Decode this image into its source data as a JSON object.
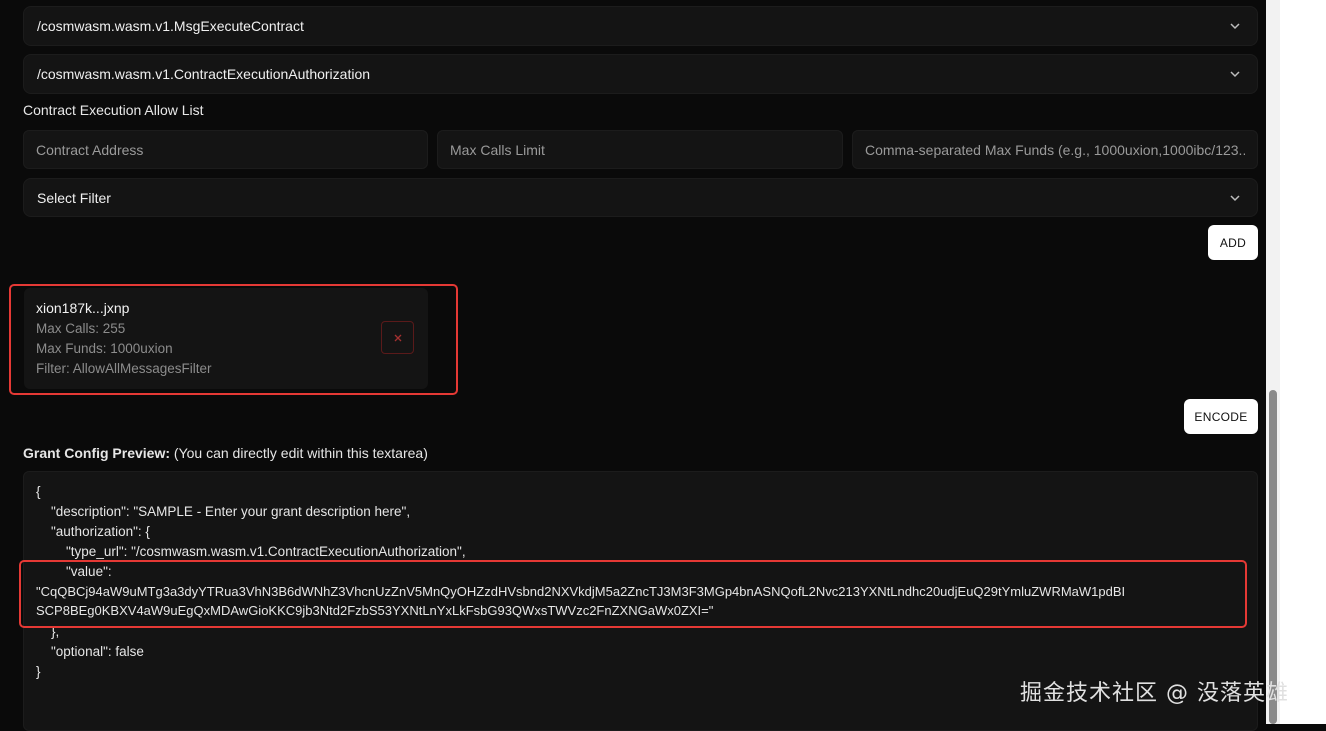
{
  "message_type_select": {
    "value": "/cosmwasm.wasm.v1.MsgExecuteContract"
  },
  "authorization_type_select": {
    "value": "/cosmwasm.wasm.v1.ContractExecutionAuthorization"
  },
  "allow_list": {
    "label": "Contract Execution Allow List",
    "contract_address_placeholder": "Contract Address",
    "max_calls_placeholder": "Max Calls Limit",
    "max_funds_placeholder": "Comma-separated Max Funds (e.g., 1000uxion,1000ibc/123...)",
    "filter_select": "Select Filter",
    "add_label": "ADD"
  },
  "entry": {
    "address": "xion187k...jxnp",
    "max_calls": "Max Calls: 255",
    "max_funds": "Max Funds: 1000uxion",
    "filter": "Filter: AllowAllMessagesFilter"
  },
  "encode_label": "ENCODE",
  "preview": {
    "label_bold": "Grant Config Preview:",
    "label_rest": " (You can directly edit within this textarea)",
    "lines": [
      "{",
      "    \"description\": \"SAMPLE - Enter your grant description here\",",
      "    \"authorization\": {",
      "        \"type_url\": \"/cosmwasm.wasm.v1.ContractExecutionAuthorization\",",
      "        \"value\":",
      "\"CqQBCj94aW9uMTg3a3dyYTRua3VhN3B6dWNhZ3VhcnUzZnV5MnQyOHZzdHVsbnd2NXVkdjM5a2ZncTJ3M3F3MGp4bnASNQofL2Nvc213YXNtLndhc20udjEuQ29tYmluZWRMaW1pdBI",
      "SCP8BEg0KBXV4aW9uEgQxMDAwGioKKC9jb3Ntd2FzbS53YXNtLnYxLkFsbG93QWxsTWVzc2FnZXNGaWx0ZXI=\"",
      "    },",
      "    \"optional\": false",
      "}"
    ]
  },
  "watermark": "掘金技术社区 @ 没落英雄",
  "colors": {
    "highlight": "#e53935",
    "background": "#0a0a0a",
    "panel": "#141414"
  },
  "icons": {
    "select_chevron": "chevron-down-icon",
    "remove": "close-icon"
  }
}
